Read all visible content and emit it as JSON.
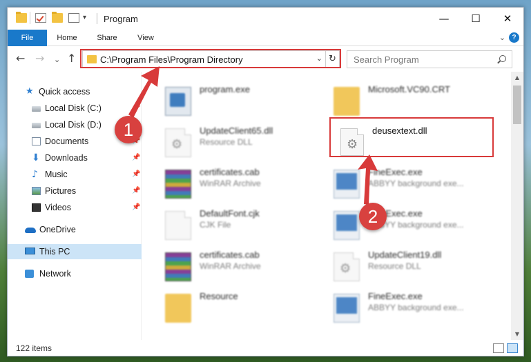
{
  "window": {
    "title": "Program",
    "controls": {
      "minimize": "—",
      "maximize": "☐",
      "close": "✕"
    }
  },
  "ribbon": {
    "tabs": [
      "File",
      "Home",
      "Share",
      "View"
    ],
    "expand": "⌄",
    "help": "?"
  },
  "nav": {
    "back": "←",
    "forward": "→",
    "recent": "⌄",
    "up": "↑",
    "address": "C:\\Program Files\\Program Directory",
    "address_chevron": "⌄",
    "refresh": "↻",
    "search_placeholder": "Search Program"
  },
  "sidebar": {
    "items": [
      {
        "label": "Quick access",
        "icon": "star-icon"
      },
      {
        "label": "Local Disk (C:)",
        "icon": "disk-icon",
        "pinned": true
      },
      {
        "label": "Local Disk (D:)",
        "icon": "disk-icon",
        "pinned": true
      },
      {
        "label": "Documents",
        "icon": "documents-icon",
        "pinned": true
      },
      {
        "label": "Downloads",
        "icon": "download-icon",
        "pinned": true
      },
      {
        "label": "Music",
        "icon": "music-icon",
        "pinned": true
      },
      {
        "label": "Pictures",
        "icon": "pictures-icon",
        "pinned": true
      },
      {
        "label": "Videos",
        "icon": "videos-icon",
        "pinned": true
      },
      {
        "label": "OneDrive",
        "icon": "onedrive-icon"
      },
      {
        "label": "This PC",
        "icon": "computer-icon",
        "selected": true
      },
      {
        "label": "Network",
        "icon": "network-icon"
      }
    ],
    "pin_glyph": "📌"
  },
  "files": [
    {
      "name": "program.exe",
      "type": "",
      "icon": "setup-icon",
      "blurred": true
    },
    {
      "name": "Microsoft.VC90.CRT",
      "type": "",
      "icon": "folder-icon",
      "blurred": true
    },
    {
      "name": "UpdateClient65.dll",
      "type": "Resource DLL",
      "icon": "dll-icon",
      "blurred": true
    },
    {
      "name": "deusextext.dll",
      "type": "",
      "icon": "dll-icon",
      "blurred": false
    },
    {
      "name": "certificates.cab",
      "type": "WinRAR Archive",
      "icon": "archive-icon",
      "blurred": true
    },
    {
      "name": "FineExec.exe",
      "type": "ABBYY background exe...",
      "icon": "exe-icon",
      "blurred": true
    },
    {
      "name": "DefaultFont.cjk",
      "type": "CJK File",
      "icon": "file-icon",
      "blurred": true
    },
    {
      "name": "FineExec.exe",
      "type": "ABBYY background exe...",
      "icon": "exe-icon",
      "blurred": true
    },
    {
      "name": "certificates.cab",
      "type": "WinRAR Archive",
      "icon": "archive-icon",
      "blurred": true
    },
    {
      "name": "UpdateClient19.dll",
      "type": "Resource DLL",
      "icon": "dll-icon",
      "blurred": true
    },
    {
      "name": "Resource",
      "type": "",
      "icon": "folder-icon",
      "blurred": true
    },
    {
      "name": "FineExec.exe",
      "type": "ABBYY background exe...",
      "icon": "exe-icon",
      "blurred": true
    }
  ],
  "status": {
    "item_count": "122 items"
  },
  "annotations": {
    "step1": "1",
    "step2": "2",
    "color": "#d83a3a"
  }
}
